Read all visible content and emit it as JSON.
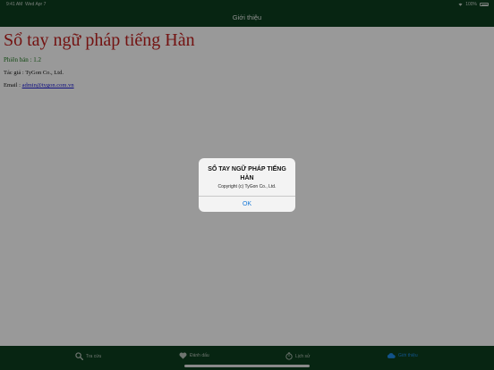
{
  "status_bar": {
    "time": "9:41 AM",
    "date": "Wed Apr 7",
    "battery": "100%"
  },
  "nav": {
    "title": "Giới thiệu"
  },
  "content": {
    "title": "Sổ tay ngữ pháp tiếng Hàn",
    "version": "Phiên bản : 1.2",
    "author": "Tác giả : TyGon Co., Ltd.",
    "email_label": "Email : ",
    "email": "admin@tygon.com.vn"
  },
  "alert": {
    "title": "SỔ TAY NGỮ PHÁP TIẾNG HÀN",
    "message": "Copyright (c) TyGon Co., Ltd.",
    "ok_label": "OK"
  },
  "tabs": [
    {
      "label": "Tra cứu",
      "icon": "search-icon"
    },
    {
      "label": "Đánh dấu",
      "icon": "heart-icon"
    },
    {
      "label": "Lịch sử",
      "icon": "history-icon"
    },
    {
      "label": "Giới thiệu",
      "icon": "about-icon",
      "active": true
    }
  ],
  "colors": {
    "bar": "#0c3e1e",
    "title_red": "#c0211f",
    "version_green": "#1f7a1f",
    "link_blue": "#1a1ad6",
    "active_tab": "#1e8be6",
    "alert_button": "#1a7ad8"
  }
}
